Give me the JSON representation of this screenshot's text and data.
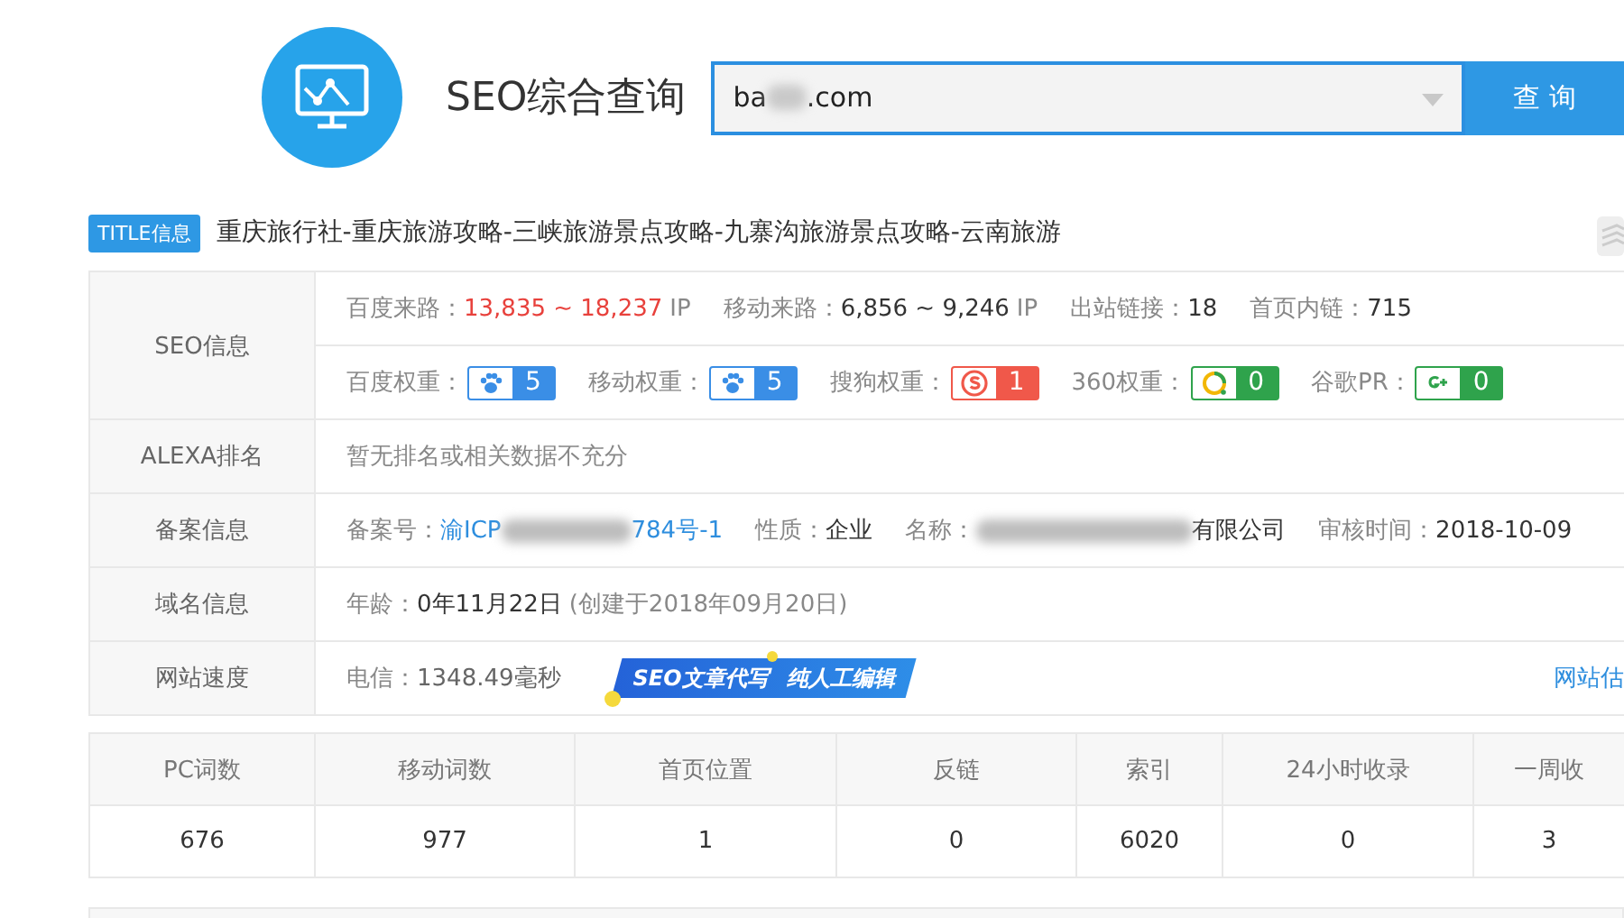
{
  "header": {
    "title": "SEO综合查询",
    "search": {
      "value": "ba",
      "value_end": ".com"
    },
    "button": "查 询"
  },
  "title_info": {
    "badge": "TITLE信息",
    "text": "重庆旅行社-重庆旅游攻略-三峡旅游景点攻略-九寨沟旅游景点攻略-云南旅游"
  },
  "info": [
    {
      "label": "SEO信息",
      "lines": [
        [
          {
            "kind": "alert",
            "label": "百度来路：",
            "value": "13,835 ~ 18,237",
            "unit": "IP"
          },
          {
            "kind": "pair",
            "label": "移动来路：",
            "value": "6,856 ~ 9,246",
            "unit": "IP"
          },
          {
            "kind": "pair",
            "label": "出站链接：",
            "value": "18"
          },
          {
            "kind": "pair",
            "label": "首页内链：",
            "value": "715"
          }
        ],
        [
          {
            "kind": "weight",
            "label": "百度权重：",
            "value": "5",
            "color": "#3a8ee6"
          },
          {
            "kind": "weight",
            "label": "移动权重：",
            "value": "5",
            "color": "#3a8ee6"
          },
          {
            "kind": "weight",
            "label": "搜狗权重：",
            "value": "1",
            "color": "#f0584a"
          },
          {
            "kind": "weight",
            "label": "360权重：",
            "value": "0",
            "color": "#2fa34c"
          },
          {
            "kind": "weight",
            "label": "谷歌PR：",
            "value": "0",
            "color": "#2fa34c"
          }
        ]
      ]
    },
    {
      "label": "ALEXA排名",
      "lines": [
        [
          {
            "kind": "note",
            "text": "暂无排名或相关数据不充分"
          }
        ]
      ]
    },
    {
      "label": "备案信息",
      "lines": [
        [
          {
            "kind": "link",
            "label": "备案号：",
            "value": "渝ICP",
            "value_end": "784号-1"
          },
          {
            "kind": "pair",
            "label": "性质：",
            "value": "企业"
          },
          {
            "kind": "masked",
            "label": "名称：",
            "value": "有限公司"
          },
          {
            "kind": "pair",
            "label": "审核时间：",
            "value": "2018-10-09"
          }
        ]
      ]
    },
    {
      "label": "域名信息",
      "lines": [
        [
          {
            "kind": "pair",
            "label": "年龄：",
            "value": "0年11月22日",
            "unit": "(创建于2018年09月20日)"
          }
        ]
      ]
    },
    {
      "label": "网站速度",
      "lines": [
        [
          {
            "kind": "muted",
            "label": "电信：",
            "value": "1348.49毫秒"
          },
          {
            "kind": "ad",
            "text": "SEO文章代写",
            "text_end": "纯人工编辑"
          },
          {
            "kind": "more",
            "text": "网站估"
          }
        ]
      ]
    }
  ],
  "stats": {
    "columns": [
      "PC词数",
      "移动词数",
      "首页位置",
      "反链",
      "索引",
      "24小时收录",
      "一周收"
    ],
    "rows": [
      [
        "676",
        "977",
        "1",
        "0",
        "6020",
        "0",
        "3"
      ]
    ]
  }
}
